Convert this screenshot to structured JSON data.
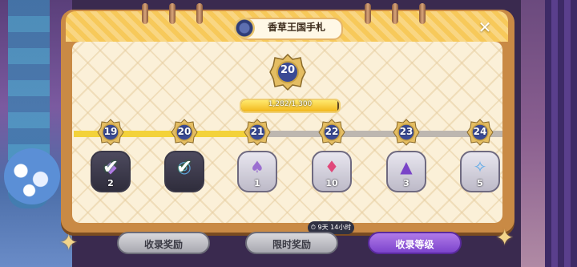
{
  "title": "香草王国手札",
  "current_level": "20",
  "progress": {
    "text": "1,282/1,300",
    "fraction": 0.986
  },
  "track": {
    "fill_fraction": 0.42
  },
  "levels": [
    {
      "num": "19",
      "count": "2",
      "claimed": true,
      "icon": "purple-gem-icon"
    },
    {
      "num": "20",
      "count": "",
      "claimed": true,
      "icon": "token-icon"
    },
    {
      "num": "21",
      "count": "1",
      "claimed": false,
      "icon": "cookie-group-icon"
    },
    {
      "num": "22",
      "count": "10",
      "claimed": false,
      "icon": "pink-crystal-icon"
    },
    {
      "num": "23",
      "count": "3",
      "claimed": false,
      "icon": "purple-soulstone-icon"
    },
    {
      "num": "24",
      "count": "5",
      "claimed": false,
      "icon": "blue-crystal-icon"
    }
  ],
  "timer": "9天 14小时",
  "buttons": {
    "collect_reward": "收录奖励",
    "limited_reward": "限时奖励",
    "collect_level": "收录等级"
  },
  "colors": {
    "accent": "#8a52d6",
    "progress": "#f2b71c",
    "panel": "#c98a45"
  }
}
